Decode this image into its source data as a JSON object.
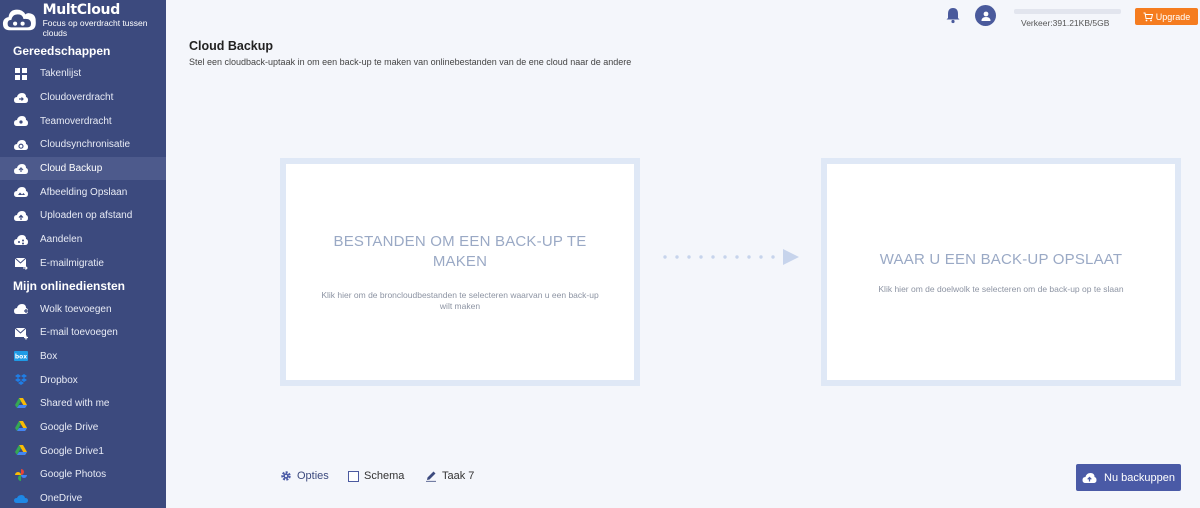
{
  "brand": {
    "name": "MultCloud",
    "tagline": "Focus op overdracht tussen clouds"
  },
  "sidebar": {
    "tools_title": "Gereedschappen",
    "tools": [
      {
        "label": "Takenlijst",
        "icon": "grid-icon"
      },
      {
        "label": "Cloudoverdracht",
        "icon": "cloud-transfer-icon"
      },
      {
        "label": "Teamoverdracht",
        "icon": "cloud-team-icon"
      },
      {
        "label": "Cloudsynchronisatie",
        "icon": "cloud-sync-icon"
      },
      {
        "label": "Cloud Backup",
        "icon": "cloud-backup-icon",
        "active": true
      },
      {
        "label": "Afbeelding Opslaan",
        "icon": "cloud-image-icon"
      },
      {
        "label": "Uploaden op afstand",
        "icon": "cloud-upload-icon"
      },
      {
        "label": "Aandelen",
        "icon": "cloud-share-icon"
      },
      {
        "label": "E-mailmigratie",
        "icon": "email-migration-icon"
      }
    ],
    "services_title": "Mijn onlinediensten",
    "services": [
      {
        "label": "Wolk toevoegen",
        "icon": "add-cloud-icon"
      },
      {
        "label": "E-mail toevoegen",
        "icon": "add-email-icon"
      },
      {
        "label": "Box",
        "icon": "box-icon"
      },
      {
        "label": "Dropbox",
        "icon": "dropbox-icon"
      },
      {
        "label": "Shared with me",
        "icon": "google-drive-icon"
      },
      {
        "label": "Google Drive",
        "icon": "google-drive-icon"
      },
      {
        "label": "Google Drive1",
        "icon": "google-drive-icon"
      },
      {
        "label": "Google Photos",
        "icon": "google-photos-icon"
      },
      {
        "label": "OneDrive",
        "icon": "onedrive-icon"
      }
    ]
  },
  "topbar": {
    "traffic": "Verkeer:391.21KB/5GB",
    "traffic_fraction": 0.0001,
    "upgrade_label": "Upgrade"
  },
  "main": {
    "title": "Cloud Backup",
    "subtitle": "Stel een cloudback-uptaak in om een back-up te maken van onlinebestanden van de ene cloud naar de andere",
    "source_heading": "BESTANDEN OM EEN BACK-UP TE MAKEN",
    "source_desc": "Klik hier om de broncloudbestanden te selecteren waarvan u een back-up wilt maken",
    "target_heading": "WAAR U EEN BACK-UP OPSLAAT",
    "target_desc": "Klik hier om de doelwolk te selecteren om de back-up op te slaan"
  },
  "footer": {
    "options_label": "Opties",
    "schedule_label": "Schema",
    "task_label": "Taak 7",
    "backup_button": "Nu backuppen"
  },
  "colors": {
    "sidebar": "#3c4a7e",
    "accent": "#4a5aa6",
    "upgrade": "#f57c1f"
  }
}
